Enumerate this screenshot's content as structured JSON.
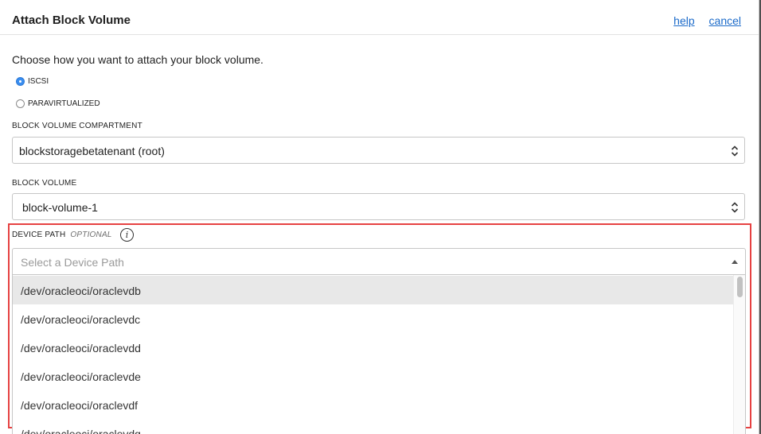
{
  "dialog": {
    "title": "Attach Block Volume",
    "help_link": "help",
    "cancel_link": "cancel",
    "intro": "Choose how you want to attach your block volume."
  },
  "attach_type": {
    "options": [
      {
        "label": "ISCSI",
        "checked": true
      },
      {
        "label": "PARAVIRTUALIZED",
        "checked": false
      }
    ]
  },
  "compartment": {
    "label": "BLOCK VOLUME COMPARTMENT",
    "value": "blockstoragebetatenant (root)"
  },
  "block_volume": {
    "label": "BLOCK VOLUME",
    "value": "block-volume-1"
  },
  "device_path": {
    "label": "DEVICE PATH",
    "optional_label": "OPTIONAL",
    "info_glyph": "i",
    "placeholder": "Select a Device Path",
    "options": [
      "/dev/oracleoci/oraclevdb",
      "/dev/oracleoci/oraclevdc",
      "/dev/oracleoci/oraclevdd",
      "/dev/oracleoci/oraclevde",
      "/dev/oracleoci/oraclevdf",
      "/dev/oracleoci/oraclevdg"
    ],
    "highlighted_index": 0
  },
  "colors": {
    "link": "#1b6ac9",
    "radio_selected": "#3a8ef0",
    "highlight_border": "#e64141"
  },
  "icons": [
    "info-icon",
    "updown-chevron-icon",
    "caret-up-icon",
    "radio-icon"
  ]
}
